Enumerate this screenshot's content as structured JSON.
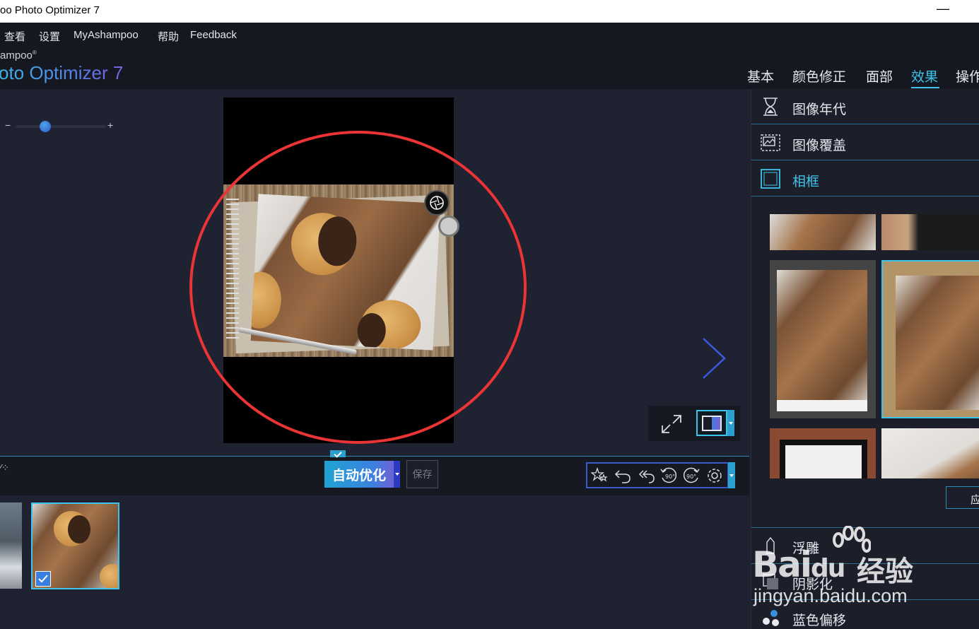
{
  "window": {
    "title": "oo Photo Optimizer 7",
    "minimize": "—"
  },
  "menu": {
    "items": [
      "查看",
      "设置",
      "MyAshampoo",
      "帮助",
      "Feedback"
    ]
  },
  "brand": {
    "small": "ampoo",
    "reg": "®",
    "big": "oto Optimizer 7"
  },
  "tabs": {
    "items": [
      "基本",
      "颜色修正",
      "面部",
      "效果",
      "操作"
    ],
    "active": "效果"
  },
  "zoom": {
    "minus": "−",
    "plus": "+",
    "level": 0.33
  },
  "toolbar": {
    "auto_label": "自动优化",
    "save_label": "保存",
    "left_glyph": "⁄⁘"
  },
  "sidebar": {
    "items": [
      {
        "label": "图像年代",
        "icon": "hourglass-icon"
      },
      {
        "label": "图像覆盖",
        "icon": "image-overlay-icon"
      },
      {
        "label": "相框",
        "icon": "frame-icon",
        "active": true
      }
    ],
    "apply_label": "应",
    "lower_items": [
      {
        "label": "浮雕",
        "icon": "emboss-icon"
      },
      {
        "label": "阴影化",
        "icon": "shadow-icon"
      },
      {
        "label": "蓝色偏移",
        "icon": "blue-shift-icon"
      }
    ]
  },
  "watermark": {
    "bai": "Bai",
    "du": "du",
    "cn": "经验",
    "url": "jingyan.baidu.com"
  },
  "colors": {
    "accent": "#3ec4ea",
    "highlight_circle": "#ea3435",
    "background": "#1f2230"
  }
}
